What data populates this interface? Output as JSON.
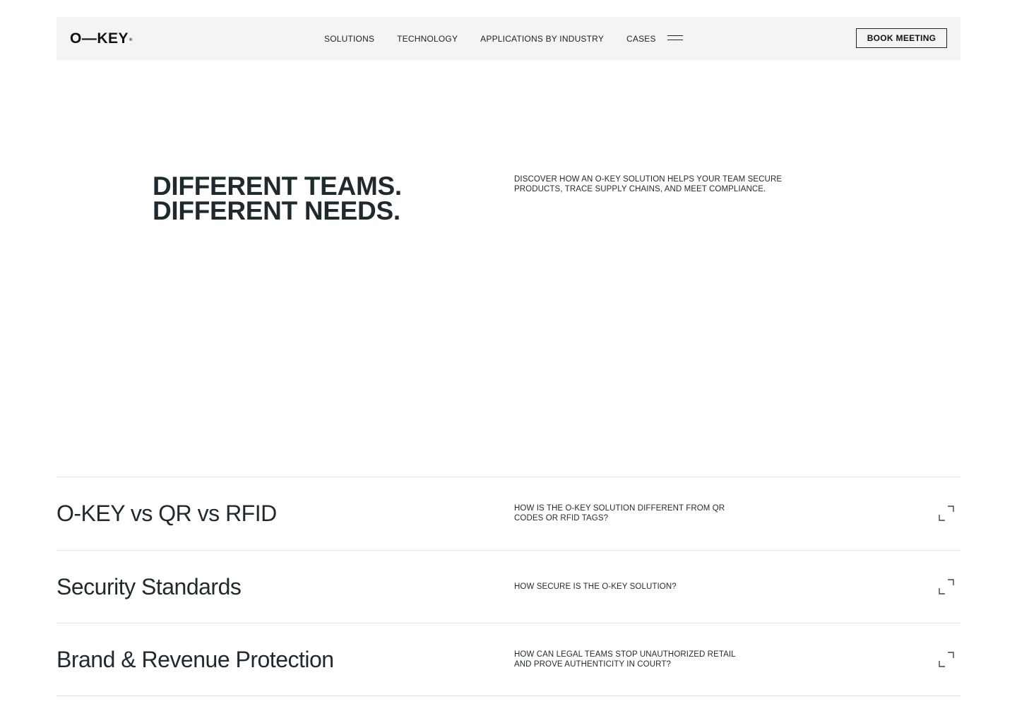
{
  "header": {
    "logo_text": "O—KEY",
    "logo_mark": "®",
    "nav": [
      {
        "label": "SOLUTIONS"
      },
      {
        "label": "TECHNOLOGY"
      },
      {
        "label": "APPLICATIONS BY INDUSTRY"
      },
      {
        "label": "CASES"
      }
    ],
    "menu_icon": "hamburger-icon",
    "cta_label": "BOOK MEETING"
  },
  "hero": {
    "title_line1": "DIFFERENT TEAMS.",
    "title_line2": "DIFFERENT NEEDS.",
    "description": "DISCOVER HOW AN O-KEY SOLUTION HELPS YOUR TEAM SECURE PRODUCTS, TRACE SUPPLY CHAINS, AND MEET COMPLIANCE."
  },
  "faq": [
    {
      "title": "O-KEY vs QR vs RFID",
      "question": "HOW IS THE O-KEY SOLUTION DIFFERENT FROM QR CODES OR RFID TAGS?",
      "icon": "expand-icon"
    },
    {
      "title": "Security Standards",
      "question": "HOW SECURE IS THE O-KEY SOLUTION?",
      "icon": "expand-icon"
    },
    {
      "title": "Brand & Revenue Protection",
      "question": "HOW CAN LEGAL TEAMS STOP UNAUTHORIZED RETAIL AND PROVE AUTHENTICITY IN COURT?",
      "icon": "expand-icon"
    }
  ],
  "colors": {
    "text": "#1f2a2e",
    "nav_bg": "#f4f4f4",
    "divider": "#e3e3e3"
  }
}
